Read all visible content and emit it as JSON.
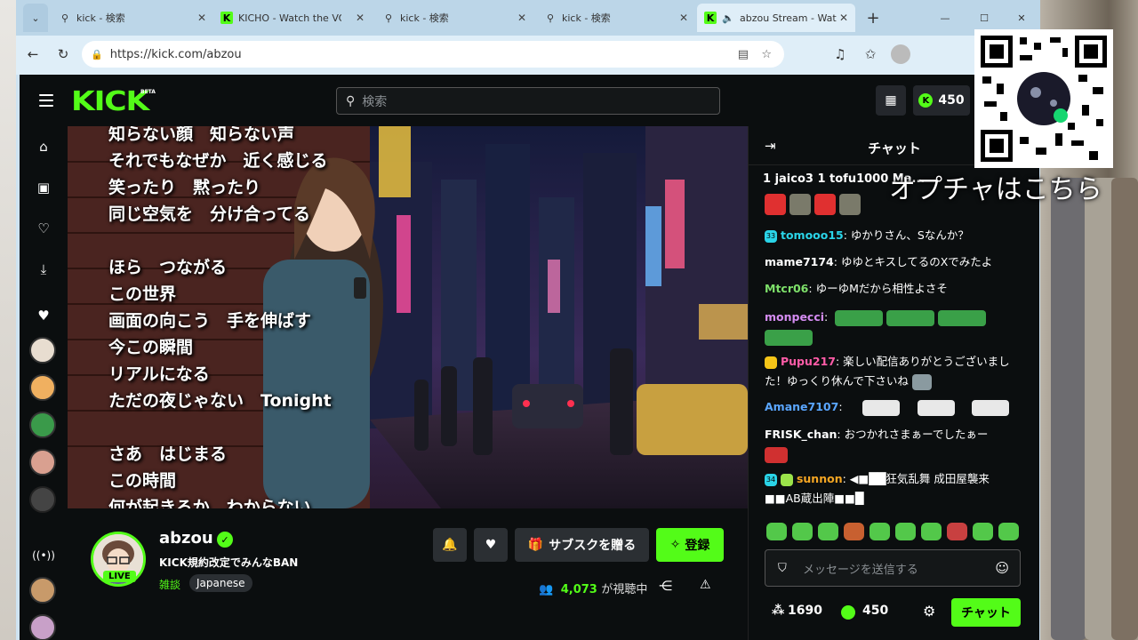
{
  "browser": {
    "tabs": [
      {
        "title": "kick - 検索",
        "icon": "search-icon"
      },
      {
        "title": "KICHO - Watch the VOD",
        "icon": "kick-favicon"
      },
      {
        "title": "kick - 検索",
        "icon": "search-icon"
      },
      {
        "title": "kick - 検索",
        "icon": "search-icon"
      },
      {
        "title": "abzou Stream - Wat",
        "icon": "kick-favicon",
        "active": true
      }
    ],
    "url": "https://kick.com/abzou"
  },
  "nav": {
    "logo": "KICK",
    "beta": "BETA",
    "search_placeholder": "検索",
    "kicks": "450"
  },
  "video": {
    "lyrics": "知らない顔　知らない声\nそれでもなぜか　近く感じる\n笑ったり　黙ったり\n同じ空気を　分け合ってる\n\nほら　つながる\nこの世界\n画面の向こう　手を伸ばす\n今この瞬間\nリアルになる\nただの夜じゃない　Tonight\n\nさあ　はじまる\nこの時間\n何が起きるか　わからない"
  },
  "channel": {
    "username": "abzou",
    "live_label": "LIVE",
    "stream_title": "KICK規約改定でみんなBAN",
    "category": "雑談",
    "tag": "Japanese",
    "gift_label": "サブスクを贈る",
    "follow_label": "登録",
    "viewer_count": "4,073",
    "viewer_label": "が視聴中"
  },
  "chat": {
    "title": "チャット",
    "leaderboard": "1   jaico3 1   tofu1000   Ma...",
    "messages": [
      {
        "badge": "33",
        "user": "tomooo15",
        "color": "#2ad4e8",
        "text": ": ゆかりさん、Sなんか？"
      },
      {
        "user": "mame7174",
        "color": "#ffffff",
        "text": ": ゆゆとキスしてるのXでみたよ"
      },
      {
        "user": "Mtcr06",
        "color": "#7ee06a",
        "text": ": ゆーゆMだから相性よさそ"
      },
      {
        "user": "monpecci",
        "color": "#d58cf2",
        "text": ":"
      },
      {
        "user": "Pupu217",
        "color": "#ff5ca8",
        "text": ": 楽しい配信ありがとうございました！ゆっくり休んで下さいね"
      },
      {
        "user": "Amane7107",
        "color": "#5aa6ff",
        "text": ":"
      },
      {
        "user": "FRISK_chan",
        "color": "#ffffff",
        "text": ": おつかれさまぁーでしたぁー"
      },
      {
        "badge": "34",
        "user": "sunnon",
        "color": "#f5a623",
        "text": ": ◀■██狂気乱舞 成田屋襲来 ■■AB蔵出陣■■█"
      }
    ],
    "input_placeholder": "メッセージを送信する",
    "points": "1690",
    "kicks": "450",
    "send_label": "チャット"
  },
  "overlay": {
    "caption": "オプチャはこちら"
  }
}
